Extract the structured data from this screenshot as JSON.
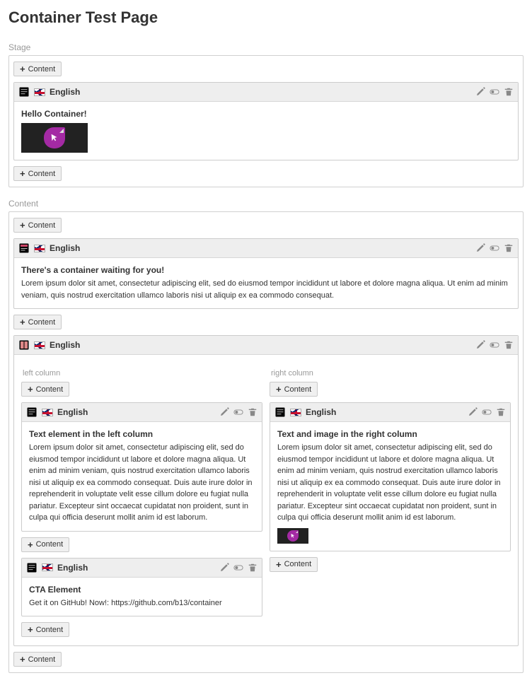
{
  "page_title": "Container Test Page",
  "labels": {
    "content_btn": "Content"
  },
  "sections": {
    "stage": {
      "title": "Stage"
    },
    "content": {
      "title": "Content"
    }
  },
  "language": "English",
  "stage_elements": [
    {
      "type": "text-image",
      "heading": "Hello Container!"
    }
  ],
  "content_elements": [
    {
      "type": "header",
      "heading": "There's a container waiting for you!",
      "body": "Lorem ipsum dolor sit amet, consectetur adipiscing elit, sed do eiusmod tempor incididunt ut labore et dolore magna aliqua. Ut enim ad minim veniam, quis nostrud exercitation ullamco laboris nisi ut aliquip ex ea commodo consequat."
    }
  ],
  "columns": {
    "left": {
      "label": "left column",
      "elements": [
        {
          "heading": "Text element in the left column",
          "body": "Lorem ipsum dolor sit amet, consectetur adipiscing elit, sed do eiusmod tempor incididunt ut labore et dolore magna aliqua. Ut enim ad minim veniam, quis nostrud exercitation ullamco laboris nisi ut aliquip ex ea commodo consequat. Duis aute irure dolor in reprehenderit in voluptate velit esse cillum dolore eu fugiat nulla pariatur. Excepteur sint occaecat cupidatat non proident, sunt in culpa qui officia deserunt mollit anim id est laborum."
        },
        {
          "heading": "CTA Element",
          "body": "Get it on GitHub! Now!: https://github.com/b13/container"
        }
      ]
    },
    "right": {
      "label": "right column",
      "elements": [
        {
          "heading": "Text and image in the right column",
          "body": "Lorem ipsum dolor sit amet, consectetur adipiscing elit, sed do eiusmod tempor incididunt ut labore et dolore magna aliqua. Ut enim ad minim veniam, quis nostrud exercitation ullamco laboris nisi ut aliquip ex ea commodo consequat. Duis aute irure dolor in reprehenderit in voluptate velit esse cillum dolore eu fugiat nulla pariatur. Excepteur sint occaecat cupidatat non proident, sunt in culpa qui officia deserunt mollit anim id est laborum."
        }
      ]
    }
  }
}
